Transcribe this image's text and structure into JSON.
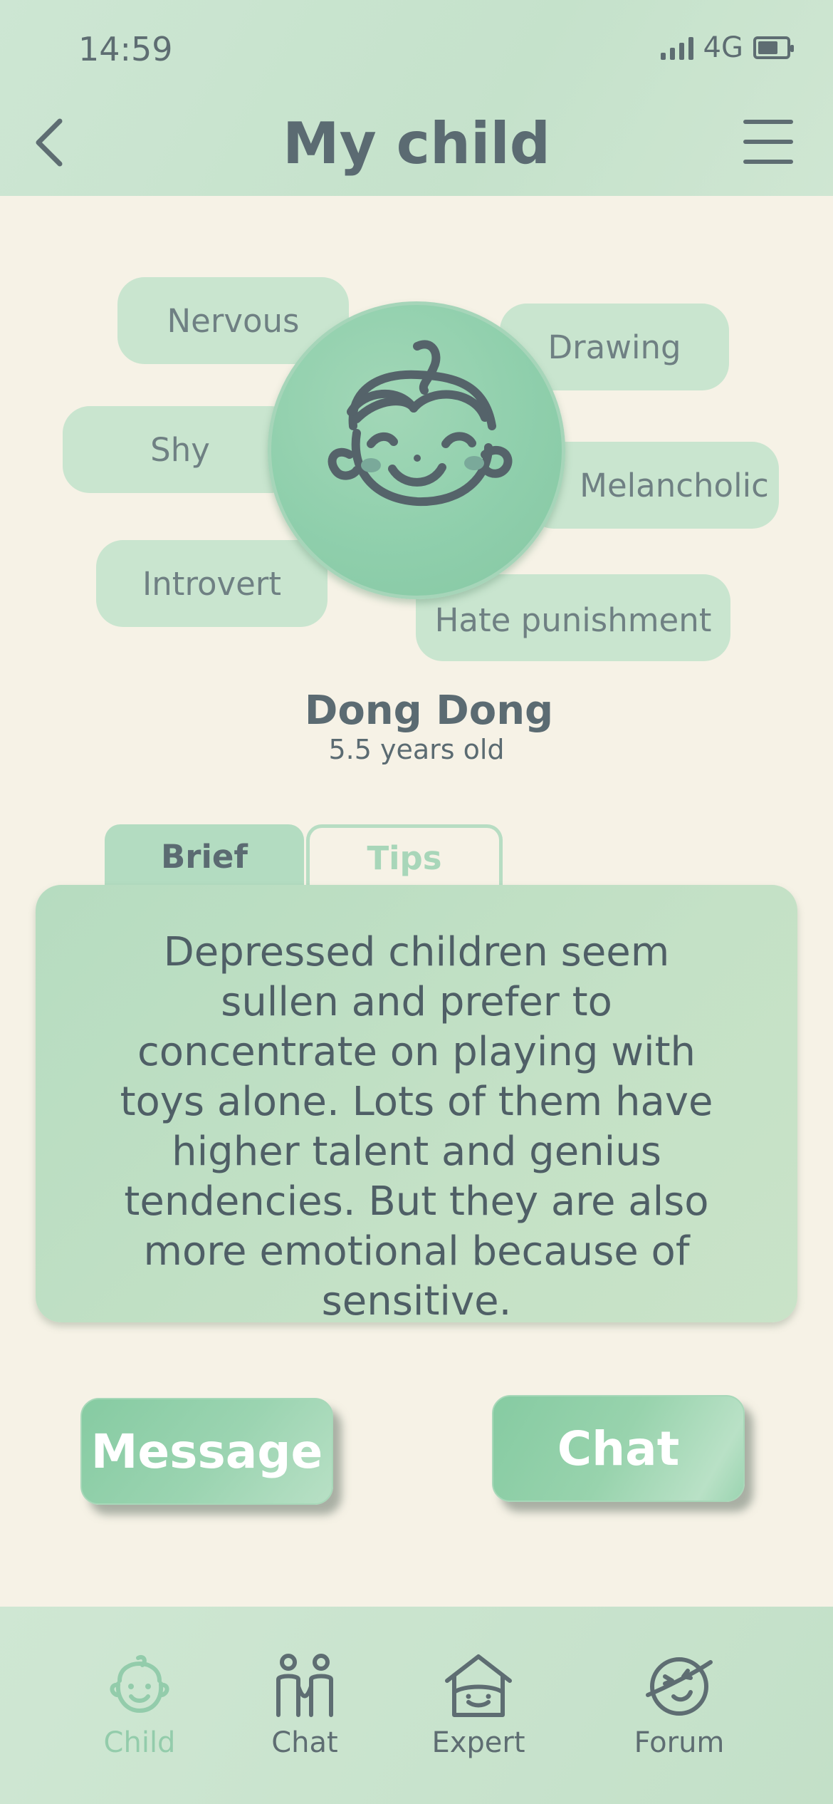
{
  "status_bar": {
    "time": "14:59",
    "network": "4G",
    "battery_level": 0.7
  },
  "header": {
    "title": "My child",
    "back_icon": "chevron-left-icon",
    "menu_icon": "hamburger-menu-icon"
  },
  "tags": [
    "Nervous",
    "Drawing",
    "Shy",
    "Melancholic",
    "Introvert",
    "Hate punishment"
  ],
  "child": {
    "name": "Dong Dong",
    "age": "5.5 years old",
    "avatar_icon": "child-face-icon"
  },
  "tabs": [
    {
      "label": "Brief",
      "active": true
    },
    {
      "label": "Tips",
      "active": false
    }
  ],
  "brief_text": "Depressed children seem sullen and prefer to concentrate on playing with toys alone. Lots of them have higher talent and genius tendencies. But they are also more emotional because of sensitive.",
  "actions": {
    "message_label": "Message",
    "chat_label": "Chat"
  },
  "bottom_nav": [
    {
      "label": "Child",
      "icon": "child-face-icon",
      "active": true
    },
    {
      "label": "Chat",
      "icon": "people-icon",
      "active": false
    },
    {
      "label": "Expert",
      "icon": "house-icon",
      "active": false
    },
    {
      "label": "Forum",
      "icon": "planet-icon",
      "active": false
    }
  ],
  "colors": {
    "accent": "#93ccab",
    "header_bg": "#c9e5cf",
    "page_bg": "#f6f2e6",
    "text": "#5b6b72"
  }
}
